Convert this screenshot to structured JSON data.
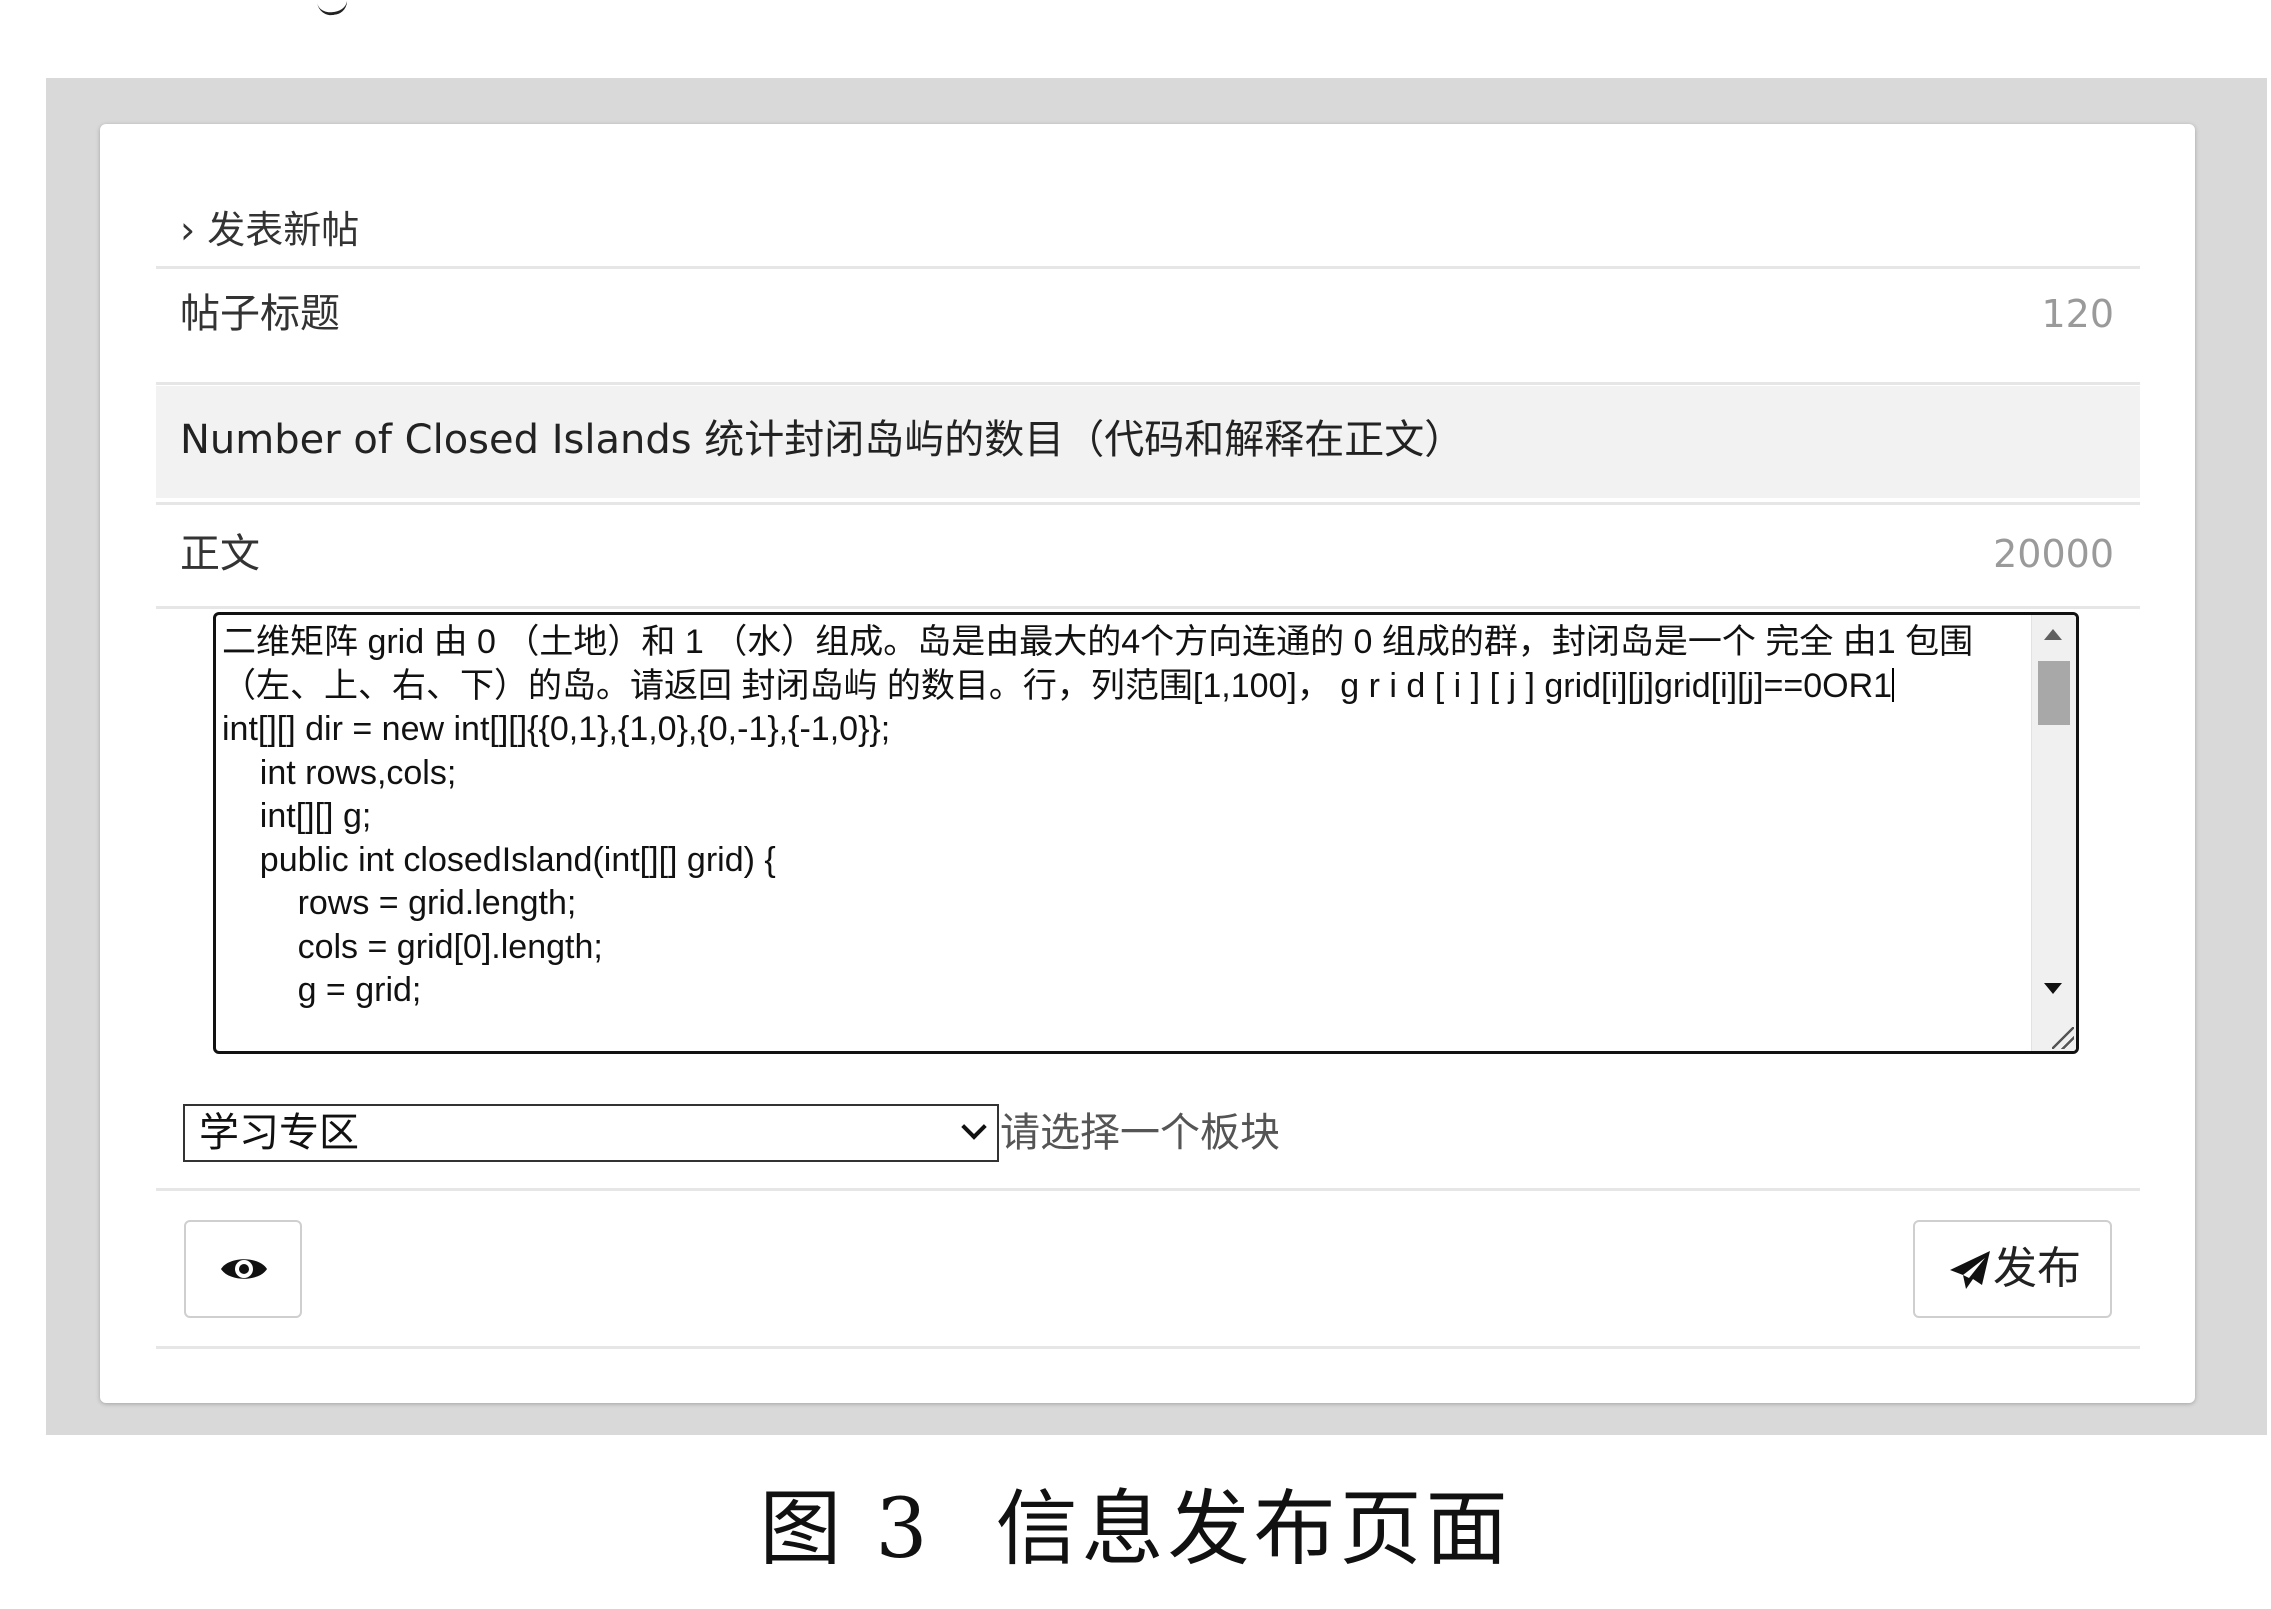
{
  "form": {
    "heading": "› 发表新帖",
    "title_label": "帖子标题",
    "title_limit": "120",
    "title_value": "Number of Closed Islands 统计封闭岛屿的数目（代码和解释在正文）",
    "body_label": "正文",
    "body_limit": "20000",
    "body_text_before_caret": "二维矩阵 grid 由 0 （土地）和 1 （水）组成。岛是由最大的4个方向连通的 0 组成的群，封闭岛是一个 完全 由1 包围（左、上、右、下）的岛。请返回 封闭岛屿 的数目。行，列范围[1,100]， g r i d [ i ] [ j ] grid[i][j]grid[i][j]==0OR1",
    "body_text_after_caret": "\nint[][] dir = new int[][]{{0,1},{1,0},{0,-1},{-1,0}};\n    int rows,cols;\n    int[][] g;\n    public int closedIsland(int[][] grid) {\n        rows = grid.length;\n        cols = grid[0].length;\n        g = grid;",
    "section_selected": "学习专区",
    "section_hint": "请选择一个板块",
    "publish_label": "发布"
  },
  "icons": {
    "preview": "eye-icon",
    "publish": "paper-plane-icon",
    "heading_chevron": "chevron-right-icon"
  },
  "caption": {
    "figure_label": "图 3",
    "figure_title": "信息发布页面"
  }
}
